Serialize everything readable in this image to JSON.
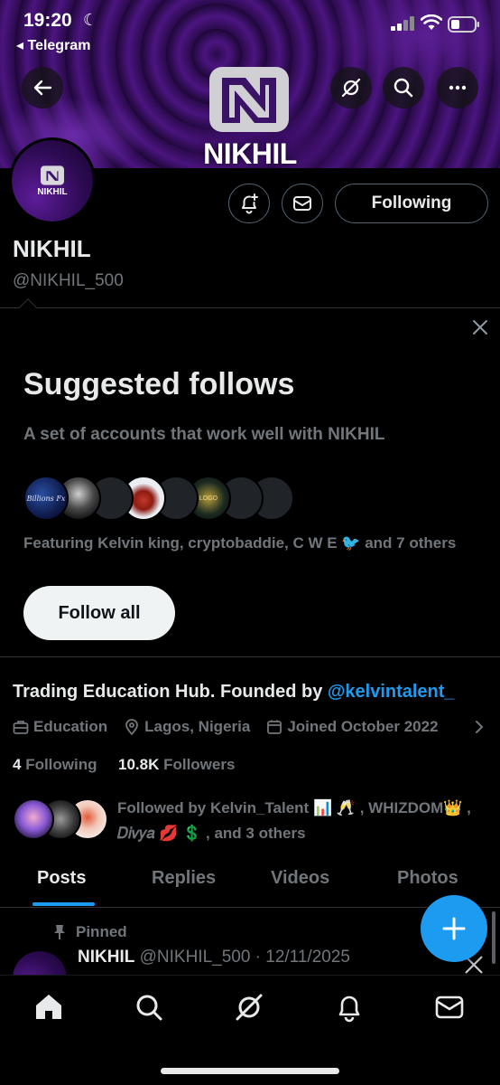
{
  "status_bar": {
    "time": "19:20",
    "back_app": "◂ Telegram"
  },
  "banner": {
    "name": "NIKHIL"
  },
  "avatar": {
    "text": "NIKHIL"
  },
  "actions": {
    "following_label": "Following"
  },
  "profile": {
    "display_name": "NIKHIL",
    "handle": "@NIKHIL_500"
  },
  "suggested": {
    "title": "Suggested follows",
    "subtitle": "A set of accounts that work well with NIKHIL",
    "featuring": "Featuring Kelvin king, cryptobaddie, C W E 🐦 and 7 others",
    "avatar_1_text": "Billions Fx",
    "avatar_6_text": "LOGO",
    "follow_all_label": "Follow all"
  },
  "bio": {
    "text": "Trading Education Hub. Founded by ",
    "mention": "@kelvintalent_"
  },
  "meta": {
    "category": "Education",
    "location": "Lagos, Nigeria",
    "joined": "Joined October 2022"
  },
  "counts": {
    "following_count": "4",
    "following_label": " Following",
    "followers_count": "10.8K",
    "followers_label": " Followers"
  },
  "followed_by": {
    "text": "Followed by Kelvin_Talent 📊 🥂 , WHIZDOM👑 , 𝐷𝑖𝑣𝑦𝑎 💋 💲 , and 3 others"
  },
  "tabs": [
    "Posts",
    "Replies",
    "Videos",
    "Photos"
  ],
  "post": {
    "pinned_label": "Pinned",
    "author": "NIKHIL",
    "handle_date": " @NIKHIL_500 · 12/11/2025"
  },
  "colors": {
    "accent": "#1d9bf0",
    "banner_purple": "#4b1580",
    "muted": "#71767b"
  }
}
